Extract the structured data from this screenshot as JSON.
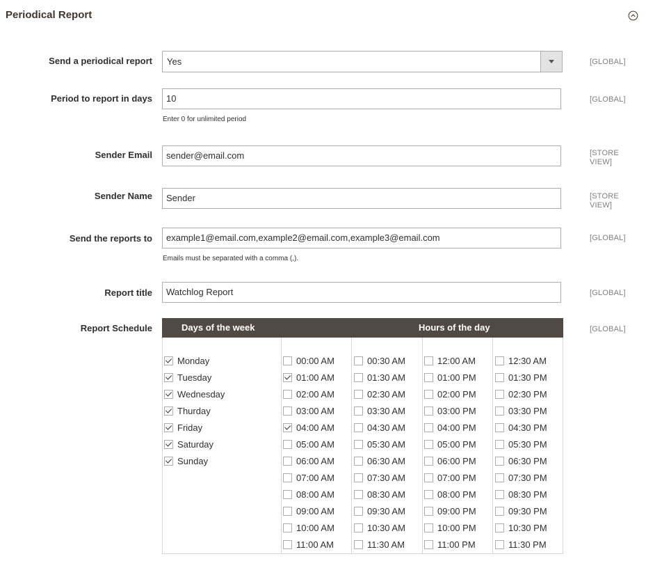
{
  "section": {
    "title": "Periodical Report"
  },
  "fields": {
    "send_report": {
      "label": "Send a periodical report",
      "value": "Yes",
      "scope": "[GLOBAL]"
    },
    "period_days": {
      "label": "Period to report in days",
      "value": "10",
      "note": "Enter 0 for unlimited period",
      "scope": "[GLOBAL]"
    },
    "sender_email": {
      "label": "Sender Email",
      "value": "sender@email.com",
      "scope_line1": "[STORE",
      "scope_line2": "VIEW]"
    },
    "sender_name": {
      "label": "Sender Name",
      "value": "Sender",
      "scope_line1": "[STORE",
      "scope_line2": "VIEW]"
    },
    "send_to": {
      "label": "Send the reports to",
      "value": "example1@email.com,example2@email.com,example3@email.com",
      "note": "Emails must be separated with a comma (,).",
      "scope": "[GLOBAL]"
    },
    "report_title": {
      "label": "Report title",
      "value": "Watchlog Report",
      "scope": "[GLOBAL]"
    },
    "schedule": {
      "label": "Report Schedule",
      "scope": "[GLOBAL]",
      "days_header": "Days of the week",
      "hours_header": "Hours of the day"
    }
  },
  "days": [
    {
      "label": "Monday",
      "checked": true
    },
    {
      "label": "Tuesday",
      "checked": true
    },
    {
      "label": "Wednesday",
      "checked": true
    },
    {
      "label": "Thurday",
      "checked": true
    },
    {
      "label": "Friday",
      "checked": true
    },
    {
      "label": "Saturday",
      "checked": true
    },
    {
      "label": "Sunday",
      "checked": true
    }
  ],
  "hours": [
    [
      {
        "label": "00:00 AM",
        "checked": false
      },
      {
        "label": "01:00 AM",
        "checked": true
      },
      {
        "label": "02:00 AM",
        "checked": false
      },
      {
        "label": "03:00 AM",
        "checked": false
      },
      {
        "label": "04:00 AM",
        "checked": true
      },
      {
        "label": "05:00 AM",
        "checked": false
      },
      {
        "label": "06:00 AM",
        "checked": false
      },
      {
        "label": "07:00 AM",
        "checked": false
      },
      {
        "label": "08:00 AM",
        "checked": false
      },
      {
        "label": "09:00 AM",
        "checked": false
      },
      {
        "label": "10:00 AM",
        "checked": false
      },
      {
        "label": "11:00 AM",
        "checked": false
      }
    ],
    [
      {
        "label": "00:30 AM",
        "checked": false
      },
      {
        "label": "01:30 AM",
        "checked": false
      },
      {
        "label": "02:30 AM",
        "checked": false
      },
      {
        "label": "03:30 AM",
        "checked": false
      },
      {
        "label": "04:30 AM",
        "checked": false
      },
      {
        "label": "05:30 AM",
        "checked": false
      },
      {
        "label": "06:30 AM",
        "checked": false
      },
      {
        "label": "07:30 AM",
        "checked": false
      },
      {
        "label": "08:30 AM",
        "checked": false
      },
      {
        "label": "09:30 AM",
        "checked": false
      },
      {
        "label": "10:30 AM",
        "checked": false
      },
      {
        "label": "11:30 AM",
        "checked": false
      }
    ],
    [
      {
        "label": "12:00 AM",
        "checked": false
      },
      {
        "label": "01:00 PM",
        "checked": false
      },
      {
        "label": "02:00 PM",
        "checked": false
      },
      {
        "label": "03:00 PM",
        "checked": false
      },
      {
        "label": "04:00 PM",
        "checked": false
      },
      {
        "label": "05:00 PM",
        "checked": false
      },
      {
        "label": "06:00 PM",
        "checked": false
      },
      {
        "label": "07:00 PM",
        "checked": false
      },
      {
        "label": "08:00 PM",
        "checked": false
      },
      {
        "label": "09:00 PM",
        "checked": false
      },
      {
        "label": "10:00 PM",
        "checked": false
      },
      {
        "label": "11:00 PM",
        "checked": false
      }
    ],
    [
      {
        "label": "12:30 AM",
        "checked": false
      },
      {
        "label": "01:30 PM",
        "checked": false
      },
      {
        "label": "02:30 PM",
        "checked": false
      },
      {
        "label": "03:30 PM",
        "checked": false
      },
      {
        "label": "04:30 PM",
        "checked": false
      },
      {
        "label": "05:30 PM",
        "checked": false
      },
      {
        "label": "06:30 PM",
        "checked": false
      },
      {
        "label": "07:30 PM",
        "checked": false
      },
      {
        "label": "08:30 PM",
        "checked": false
      },
      {
        "label": "09:30 PM",
        "checked": false
      },
      {
        "label": "10:30 PM",
        "checked": false
      },
      {
        "label": "11:30 PM",
        "checked": false
      }
    ]
  ],
  "icons": {
    "collapse": "chevron-up-circle-icon",
    "select_arrow": "chevron-down-icon"
  },
  "colors": {
    "table_header": "#514943",
    "scope_text": "#808080",
    "border": "#adadad"
  }
}
